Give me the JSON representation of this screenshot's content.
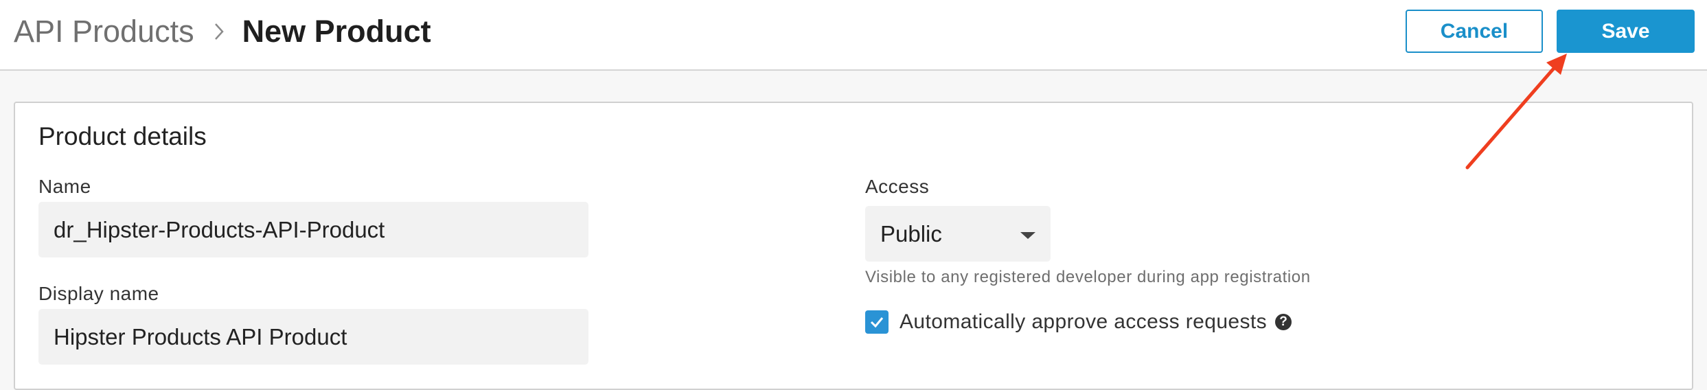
{
  "header": {
    "breadcrumb_root": "API Products",
    "breadcrumb_current": "New Product",
    "cancel_label": "Cancel",
    "save_label": "Save"
  },
  "card": {
    "section_title": "Product details",
    "name_label": "Name",
    "name_value": "dr_Hipster-Products-API-Product",
    "display_name_label": "Display name",
    "display_name_value": "Hipster Products API Product",
    "access_label": "Access",
    "access_selected": "Public",
    "access_hint": "Visible to any registered developer during app registration",
    "auto_approve_label": "Automatically approve access requests",
    "auto_approve_checked": true,
    "help_glyph": "?"
  },
  "colors": {
    "accent": "#1a95d0",
    "annotation_arrow": "#ef3e1f",
    "checkbox": "#2a93d5"
  },
  "icons": [
    "chevron-right-icon",
    "caret-down-icon",
    "checkmark-icon",
    "help-icon",
    "annotation-arrow"
  ]
}
